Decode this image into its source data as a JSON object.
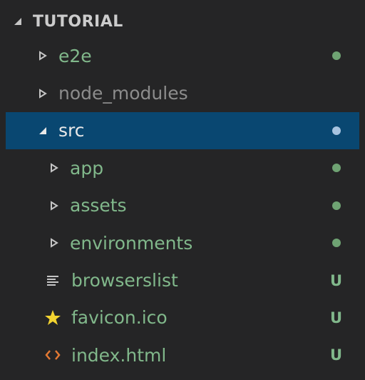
{
  "explorer": {
    "section_title": "TUTORIAL",
    "items": [
      {
        "label": "e2e",
        "decoration": "dot"
      },
      {
        "label": "node_modules",
        "decoration": ""
      },
      {
        "label": "src",
        "decoration": "dot"
      },
      {
        "label": "app",
        "decoration": "dot"
      },
      {
        "label": "assets",
        "decoration": "dot"
      },
      {
        "label": "environments",
        "decoration": "dot"
      },
      {
        "label": "browserslist",
        "badge": "U",
        "icon": "text-lines-icon"
      },
      {
        "label": "favicon.ico",
        "badge": "U",
        "icon": "star-icon"
      },
      {
        "label": "index.html",
        "badge": "U",
        "icon": "code-brackets-icon"
      }
    ]
  },
  "colors": {
    "background": "#252526",
    "selected_row": "#094771",
    "untracked_green": "#81b88b",
    "ignored_grey": "#8c8c8c",
    "star_yellow": "#f2d330",
    "html_orange": "#e37933"
  }
}
